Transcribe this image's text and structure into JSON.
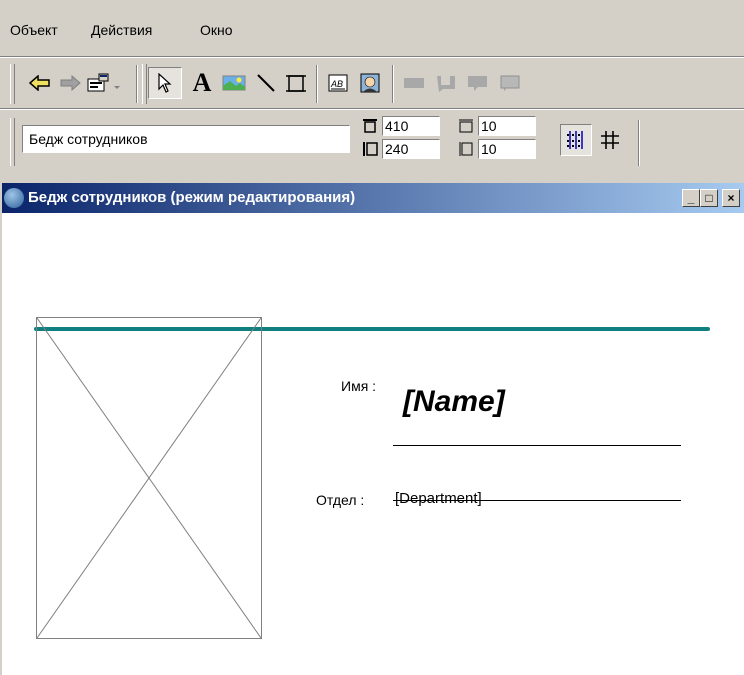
{
  "menu": {
    "items": [
      "Объект",
      "Действия",
      "Окно"
    ]
  },
  "toolbar": {
    "buttons": [
      "back-arrow",
      "forward-arrow",
      "properties",
      "dropdown",
      "pointer",
      "text",
      "image",
      "line",
      "rectangle",
      "text-field",
      "photo-field",
      "gray-block-1",
      "gray-block-2",
      "gray-block-3",
      "gray-block-4"
    ]
  },
  "props": {
    "object_name": "Бедж сотрудников",
    "width": "410",
    "height": "240",
    "grid_x": "10",
    "grid_y": "10"
  },
  "window": {
    "title": "Бедж сотрудников (режим редактирования)",
    "min_label": "_",
    "max_label": "□",
    "close_label": "×"
  },
  "badge": {
    "name_label": "Имя :",
    "name_value": "[Name]",
    "dept_label": "Отдел :",
    "dept_value": "[Department]",
    "accent_color": "#0f7f80"
  }
}
